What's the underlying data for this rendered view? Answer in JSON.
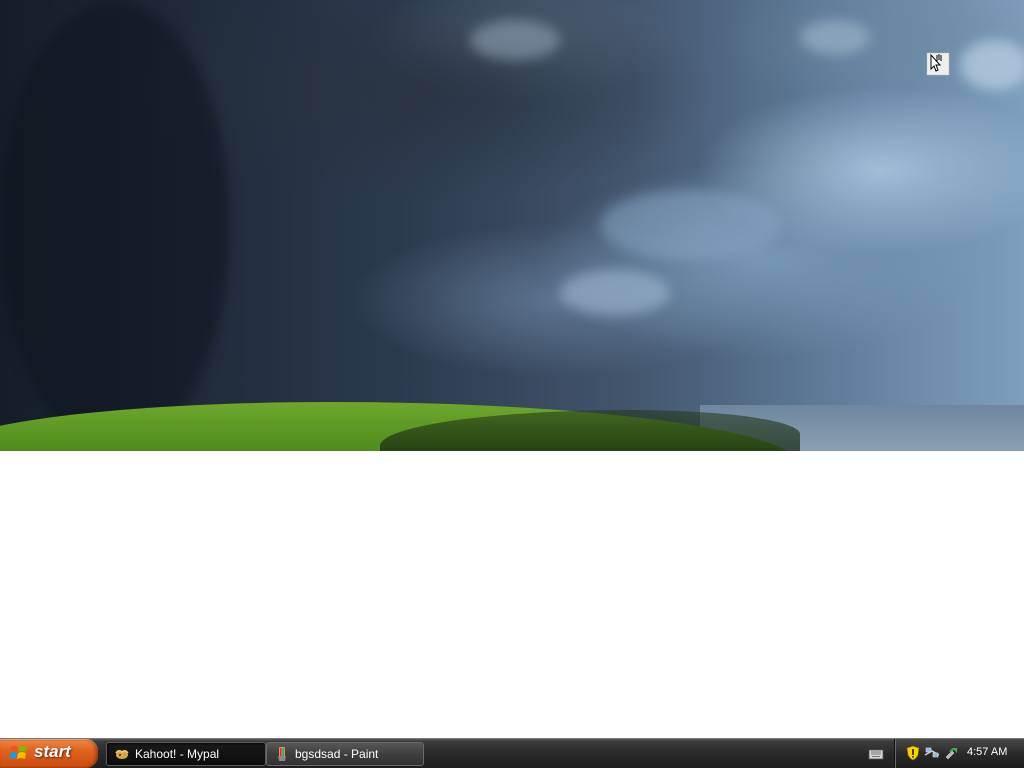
{
  "taskbar": {
    "start_label": "start",
    "tasks": [
      {
        "label": "Kahoot! - Mypal",
        "icon": "mypal-browser-icon",
        "active": true
      },
      {
        "label": "bgsdsad - Paint",
        "icon": "paint-icon",
        "active": false
      }
    ],
    "tray": {
      "icons": [
        "keyboard-icon",
        "security-shield-icon",
        "network-icon",
        "safely-remove-hardware-icon"
      ],
      "clock": "4:57 AM"
    }
  },
  "colors": {
    "start_button": "#e0621d",
    "taskbar": "#2a2a2a",
    "desktop_background": "#ffffff",
    "hill_green": "#4f8b1e"
  }
}
